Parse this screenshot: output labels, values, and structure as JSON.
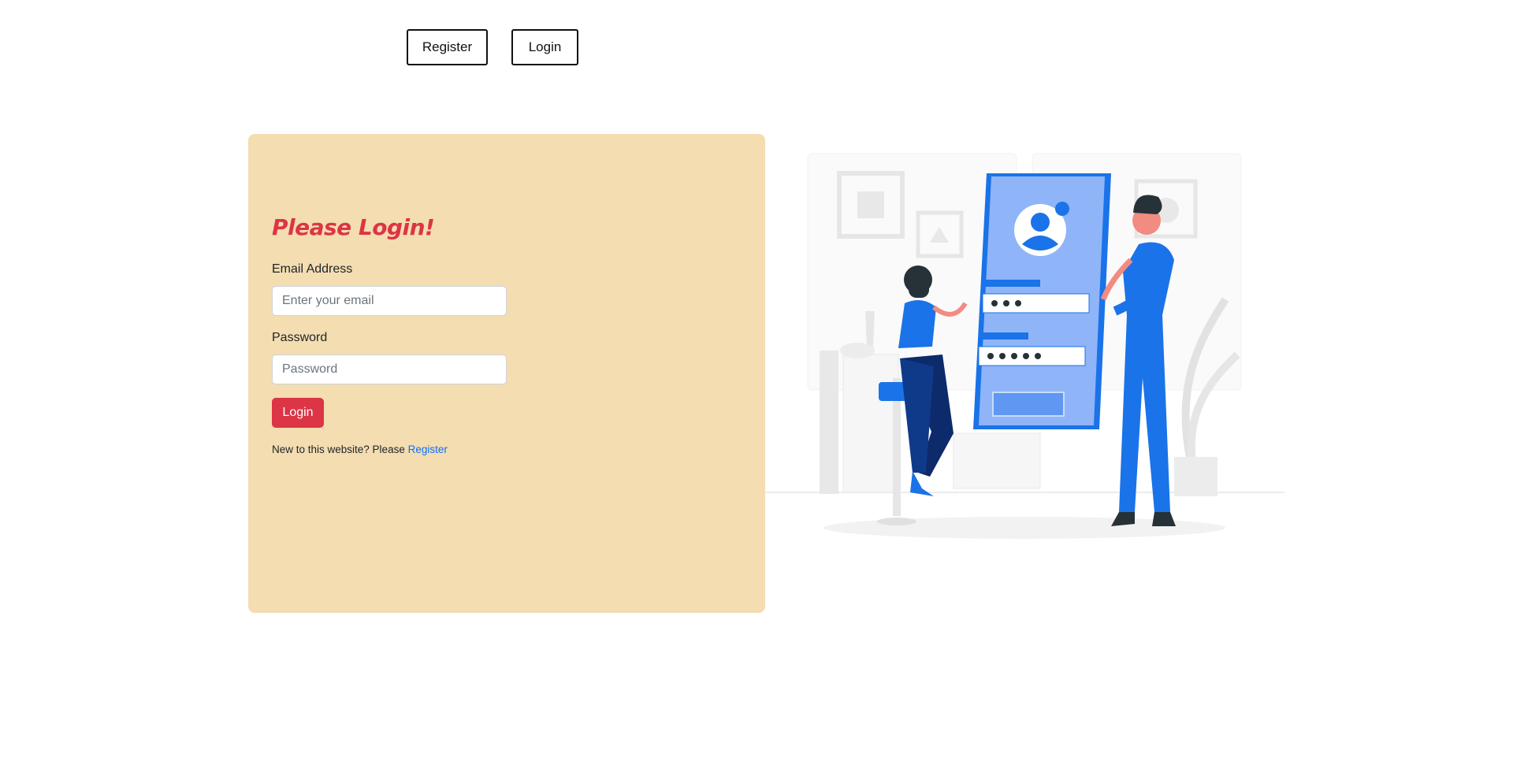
{
  "nav": {
    "register_label": "Register",
    "login_label": "Login"
  },
  "form": {
    "title": "Please Login!",
    "email_label": "Email Address",
    "email_placeholder": "Enter your email",
    "email_value": "",
    "password_label": "Password",
    "password_placeholder": "Password",
    "password_value": "",
    "submit_label": "Login",
    "footer_text": "New to this website? Please ",
    "footer_link": "Register"
  },
  "colors": {
    "card_bg": "#f3ddb1",
    "accent_red": "#dc3545",
    "link_blue": "#0d6efd",
    "illustration_blue": "#1a73e8"
  },
  "illustration": {
    "icon": "login-illustration"
  }
}
